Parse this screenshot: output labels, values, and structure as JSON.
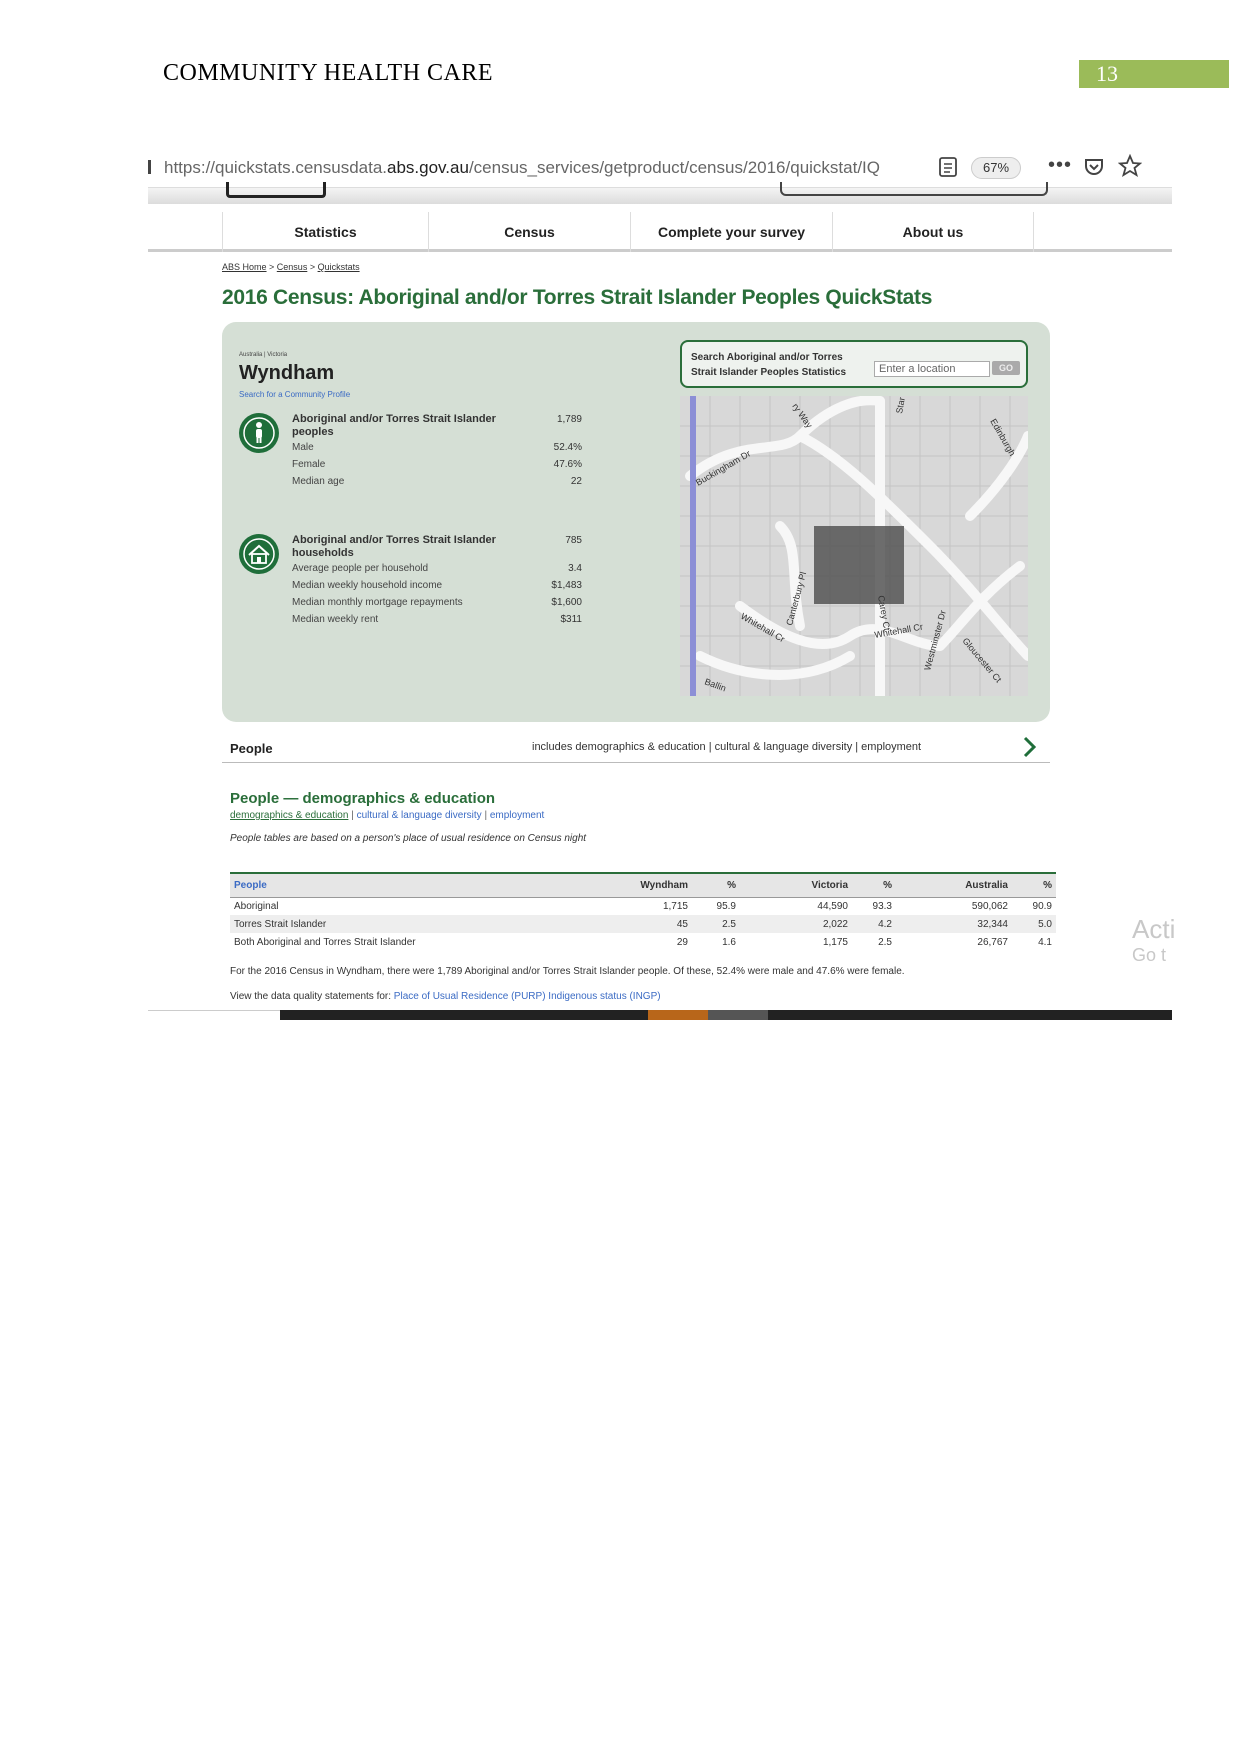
{
  "document": {
    "header_title": "COMMUNITY HEALTH CARE",
    "page_number": "13"
  },
  "browser": {
    "url_prefix": "https://quickstats.censusdata.",
    "url_domain": "abs.gov.au",
    "url_path": "/census_services/getproduct/census/2016/quickstat/IQ",
    "zoom": "67%"
  },
  "nav": {
    "items": [
      "Statistics",
      "Census",
      "Complete your survey",
      "About us"
    ]
  },
  "breadcrumb": [
    "ABS Home",
    "Census",
    "Quickstats"
  ],
  "page_title": "2016 Census: Aboriginal and/or Torres Strait Islander Peoples QuickStats",
  "place": {
    "crumb": "Australia | Victoria",
    "name": "Wyndham",
    "profile_link": "Search for a Community Profile"
  },
  "stats_people": {
    "heading": "Aboriginal and/or Torres Strait Islander peoples",
    "total": "1,789",
    "rows": [
      {
        "label": "Male",
        "value": "52.4%"
      },
      {
        "label": "Female",
        "value": "47.6%"
      },
      {
        "label": "Median age",
        "value": "22"
      }
    ]
  },
  "stats_households": {
    "heading": "Aboriginal and/or Torres Strait Islander households",
    "total": "785",
    "rows": [
      {
        "label": "Average people per household",
        "value": "3.4"
      },
      {
        "label": "Median weekly household income",
        "value": "$1,483"
      },
      {
        "label": "Median monthly mortgage repayments",
        "value": "$1,600"
      },
      {
        "label": "Median weekly rent",
        "value": "$311"
      }
    ]
  },
  "search": {
    "label": "Search Aboriginal and/or Torres Strait Islander Peoples Statistics",
    "placeholder": "Enter a location",
    "button": "GO"
  },
  "map_labels": [
    "Buckingham Dr",
    "Canterbury Pl",
    "Whitehall Cr",
    "Whitehall Cr",
    "Carey Ct",
    "Westminster Dr",
    "Gloucester Ct",
    "Edinburgh",
    "Star",
    "Ballin",
    "ry Way"
  ],
  "people_bar": {
    "title": "People",
    "links": "includes demographics & education | cultural & language diversity | employment"
  },
  "section": {
    "title": "People — demographics & education",
    "link_current": "demographics & education",
    "link_2": "cultural & language diversity",
    "link_3": "employment",
    "note": "People tables are based on a person's place of usual residence on Census night"
  },
  "table": {
    "headers": [
      "People",
      "Wyndham",
      "%",
      "Victoria",
      "%",
      "Australia",
      "%"
    ],
    "rows": [
      [
        "Aboriginal",
        "1,715",
        "95.9",
        "44,590",
        "93.3",
        "590,062",
        "90.9"
      ],
      [
        "Torres Strait Islander",
        "45",
        "2.5",
        "2,022",
        "4.2",
        "32,344",
        "5.0"
      ],
      [
        "Both Aboriginal and Torres Strait Islander",
        "29",
        "1.6",
        "1,175",
        "2.5",
        "26,767",
        "4.1"
      ]
    ]
  },
  "footnote": "For the 2016 Census in Wyndham, there were 1,789 Aboriginal and/or Torres Strait Islander people. Of these, 52.4% were male and 47.6% were female.",
  "quality": {
    "prefix": "View the data quality statements for: ",
    "link": "Place of Usual Residence (PURP) Indigenous status (INGP)"
  },
  "activate_watermark": {
    "line1": "Acti",
    "line2": "Go t"
  }
}
